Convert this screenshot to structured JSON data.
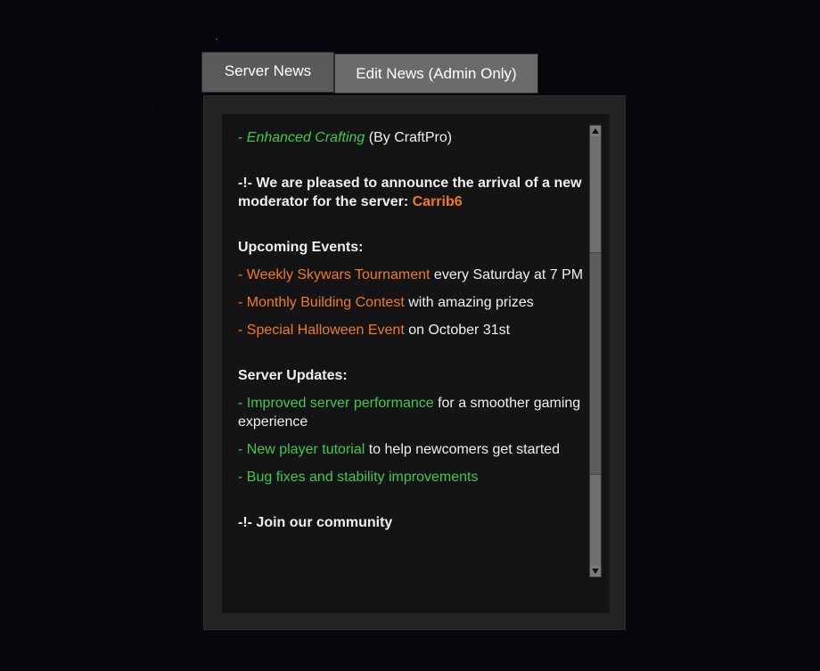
{
  "tabs": {
    "news_label": "Server News",
    "edit_label": "Edit News (Admin Only)"
  },
  "news": {
    "crafting": {
      "prefix": "- ",
      "name": "Enhanced Crafting",
      "suffix": " (By CraftPro)"
    },
    "announcement": {
      "text": "-!- We are pleased to announce the arrival of a new moderator for the server: ",
      "moderator": "Carrib6"
    },
    "events": {
      "heading": "Upcoming Events:",
      "items": [
        {
          "highlight": "- Weekly Skywars Tournament",
          "rest": " every Saturday at 7 PM"
        },
        {
          "highlight": "- Monthly Building Contest",
          "rest": " with amazing prizes"
        },
        {
          "highlight": "- Special Halloween Event",
          "rest": " on October 31st"
        }
      ]
    },
    "updates": {
      "heading": "Server Updates:",
      "items": [
        {
          "highlight": "- Improved server performance",
          "rest": " for a smoother gaming experience"
        },
        {
          "highlight": "- New player tutorial",
          "rest": " to help newcomers get started"
        },
        {
          "highlight": "- Bug fixes and stability improvements",
          "rest": ""
        }
      ]
    },
    "cutoff_line": "-!- Join our community"
  },
  "colors": {
    "green": "#3fc94a",
    "orange": "#f07a24",
    "text": "#f0f0f0",
    "panel": "#222325",
    "inner": "#141416"
  },
  "icons": {
    "scroll_up": "arrow-up-icon",
    "scroll_down": "arrow-down-icon"
  }
}
